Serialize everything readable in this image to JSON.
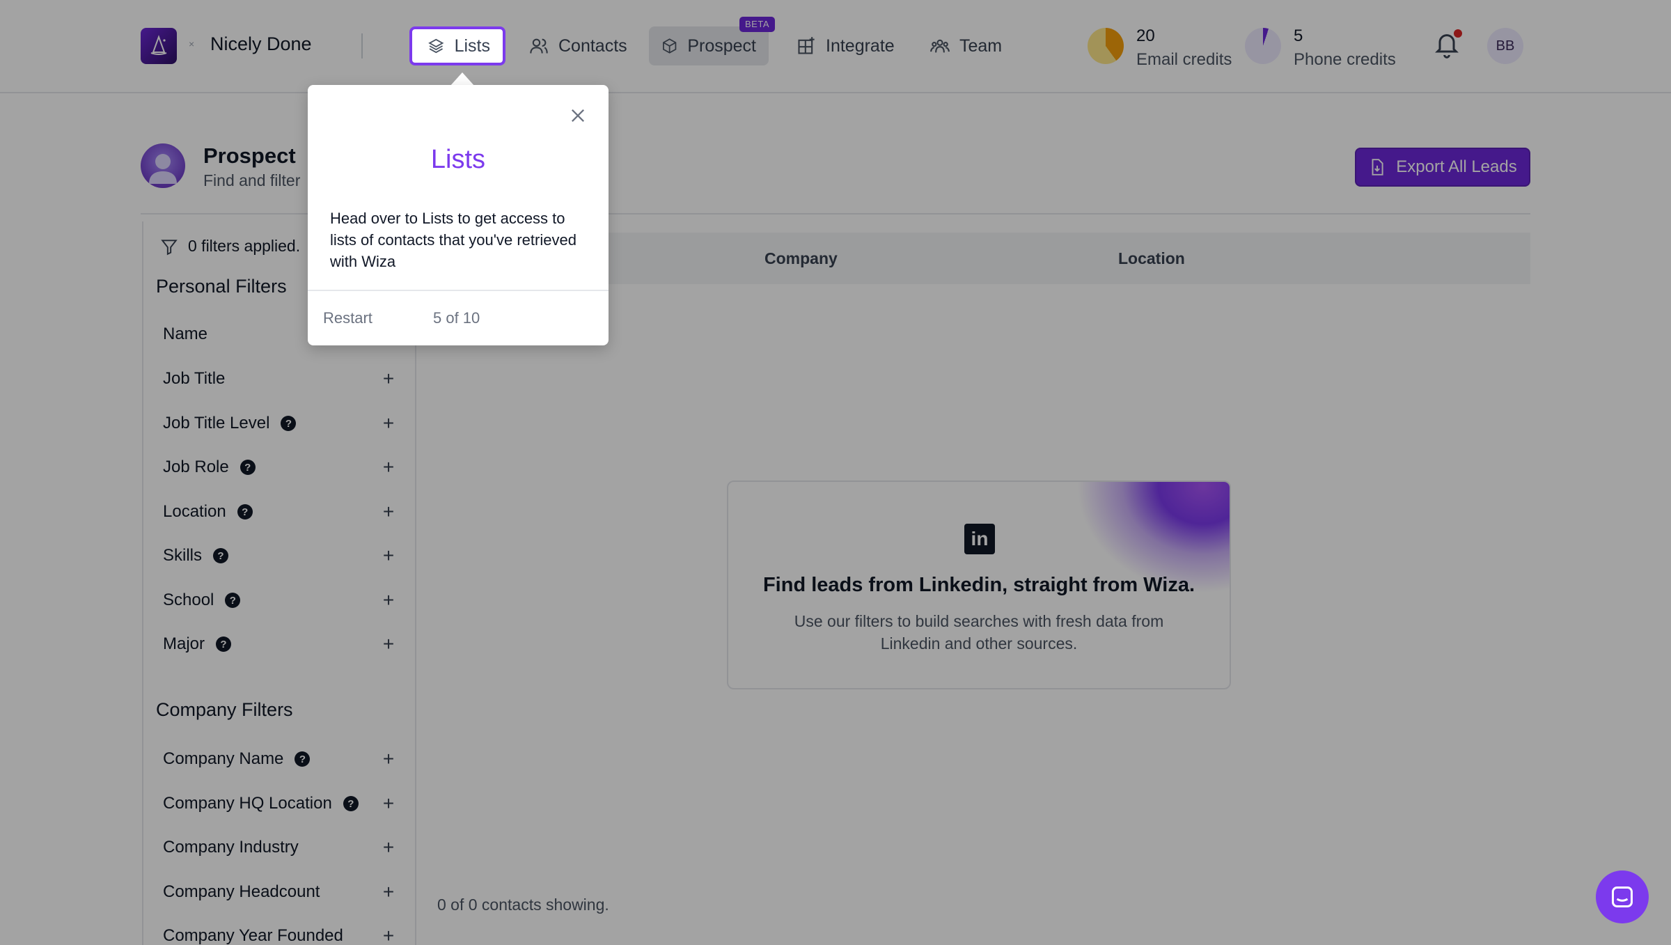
{
  "workspace": {
    "name": "Nicely Done",
    "separator": "×"
  },
  "nav": {
    "items": [
      {
        "label": "Lists",
        "icon": "layers-icon"
      },
      {
        "label": "Contacts",
        "icon": "users-icon"
      },
      {
        "label": "Prospect",
        "icon": "cube-icon",
        "badge": "BETA"
      },
      {
        "label": "Integrate",
        "icon": "grid-plus-icon"
      },
      {
        "label": "Team",
        "icon": "team-icon"
      }
    ]
  },
  "credits": {
    "email": {
      "value": "20",
      "label": "Email credits",
      "fill_fraction": 0.4,
      "color": "#f59e0b"
    },
    "phone": {
      "value": "5",
      "label": "Phone credits",
      "fill_fraction": 0.05,
      "color": "#6d28d9"
    }
  },
  "user": {
    "initials": "BB",
    "has_notification": true
  },
  "page": {
    "title": "Prospect",
    "subtitle": "Find and filter",
    "export_label": "Export All Leads"
  },
  "filters": {
    "applied_text": "0 filters applied.",
    "personal_title": "Personal Filters",
    "personal": [
      {
        "label": "Name",
        "help": false
      },
      {
        "label": "Job Title",
        "help": false
      },
      {
        "label": "Job Title Level",
        "help": true
      },
      {
        "label": "Job Role",
        "help": true
      },
      {
        "label": "Location",
        "help": true
      },
      {
        "label": "Skills",
        "help": true
      },
      {
        "label": "School",
        "help": true
      },
      {
        "label": "Major",
        "help": true
      }
    ],
    "company_title": "Company Filters",
    "company": [
      {
        "label": "Company Name",
        "help": true
      },
      {
        "label": "Company HQ Location",
        "help": true
      },
      {
        "label": "Company Industry",
        "help": false
      },
      {
        "label": "Company Headcount",
        "help": false
      },
      {
        "label": "Company Year Founded",
        "help": false
      }
    ]
  },
  "table": {
    "columns": [
      "Company",
      "Location"
    ],
    "showing_text": "0 of 0 contacts showing."
  },
  "empty_state": {
    "title": "Find leads from Linkedin, straight from Wiza.",
    "description": "Use our filters to build searches with fresh data from Linkedin and other sources.",
    "logo_text": "in"
  },
  "tour": {
    "title": "Lists",
    "body": "Head over to Lists to get access to lists of contacts that you've retrieved with Wiza",
    "restart_label": "Restart",
    "step_text": "5 of 10"
  },
  "colors": {
    "accent": "#7c3aed",
    "brand_dark": "#6d28d9",
    "notification": "#dc2626"
  }
}
